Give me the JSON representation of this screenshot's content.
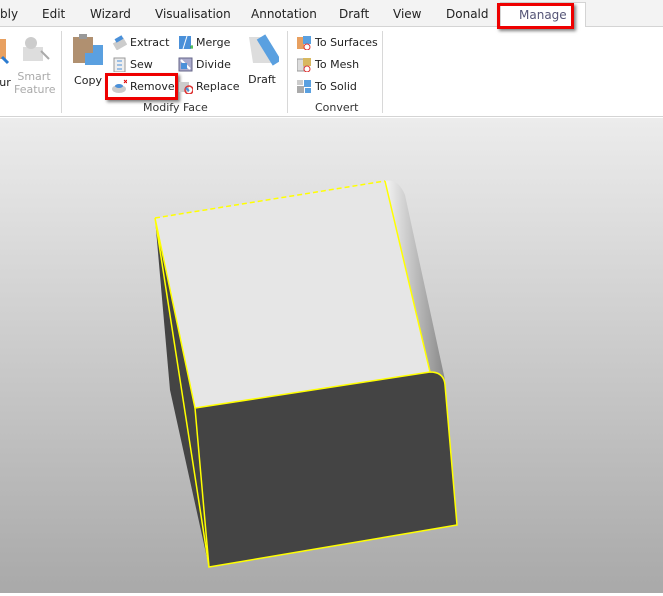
{
  "tabs": [
    "bly",
    "Edit",
    "Wizard",
    "Visualisation",
    "Annotation",
    "Draft",
    "View",
    "Donald",
    "Manage"
  ],
  "active_tab": "Manage",
  "ribbon": {
    "left_partial": {
      "contour": "ur",
      "smart_feature": "Smart Feature"
    },
    "modify_face": {
      "copy": "Copy",
      "extract": "Extract",
      "sew": "Sew",
      "remove": "Remove",
      "merge": "Merge",
      "divide": "Divide",
      "replace": "Replace",
      "draft": "Draft",
      "group_label": "Modify Face"
    },
    "convert": {
      "to_surfaces": "To Surfaces",
      "to_mesh": "To Mesh",
      "to_solid": "To Solid",
      "group_label": "Convert"
    }
  },
  "colors": {
    "highlight": "#e00000",
    "selection": "#ffff00",
    "face_dark": "#444444"
  }
}
